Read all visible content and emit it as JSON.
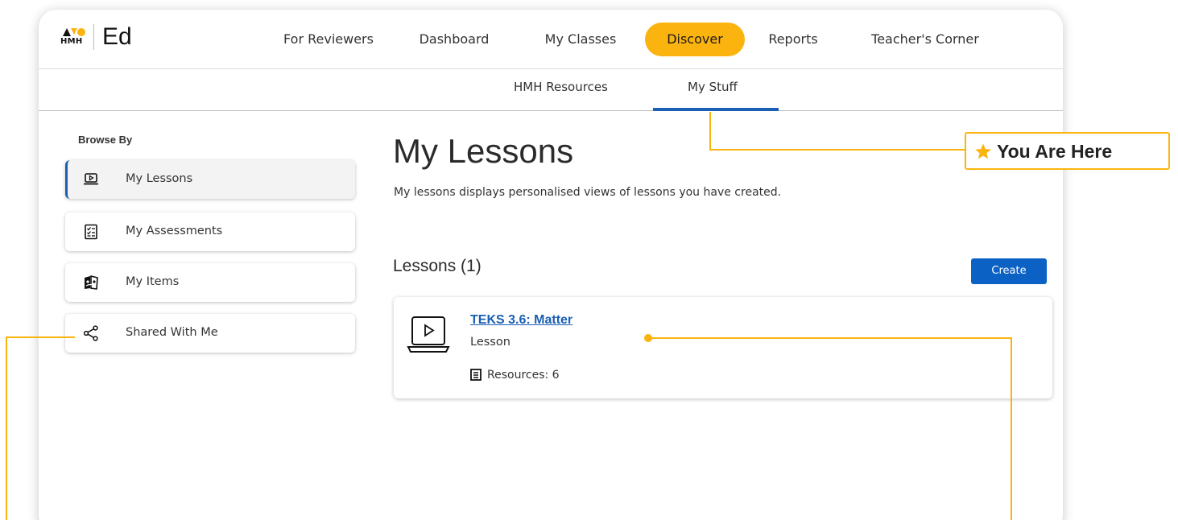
{
  "brand": {
    "logo_text": "HMH",
    "app_name": "Ed"
  },
  "top_nav": [
    {
      "label": "For Reviewers",
      "active": false
    },
    {
      "label": "Dashboard",
      "active": false
    },
    {
      "label": "My Classes",
      "active": false
    },
    {
      "label": "Discover",
      "active": true
    },
    {
      "label": "Reports",
      "active": false
    },
    {
      "label": "Teacher's Corner",
      "active": false
    }
  ],
  "sub_nav": [
    {
      "label": "HMH Resources",
      "active": false
    },
    {
      "label": "My Stuff",
      "active": true
    }
  ],
  "sidebar": {
    "heading": "Browse By",
    "items": [
      {
        "label": "My Lessons",
        "icon": "laptop-play-icon",
        "active": true
      },
      {
        "label": "My Assessments",
        "icon": "checklist-icon",
        "active": false
      },
      {
        "label": "My Items",
        "icon": "items-icon",
        "active": false
      },
      {
        "label": "Shared With Me",
        "icon": "share-icon",
        "active": false
      }
    ]
  },
  "main": {
    "title": "My Lessons",
    "description": "My lessons displays personalised views of lessons you have created.",
    "section_title": "Lessons (1)",
    "create_label": "Create",
    "lessons": [
      {
        "title": "TEKS 3.6: Matter",
        "type": "Lesson",
        "resources": "Resources: 6",
        "icon": "laptop-play-icon"
      }
    ]
  },
  "callout": {
    "text": "You Are Here",
    "icon": "star-icon"
  },
  "colors": {
    "accent": "#fbb40f",
    "link": "#1a5fb4",
    "primary_button": "#0b61c4"
  }
}
